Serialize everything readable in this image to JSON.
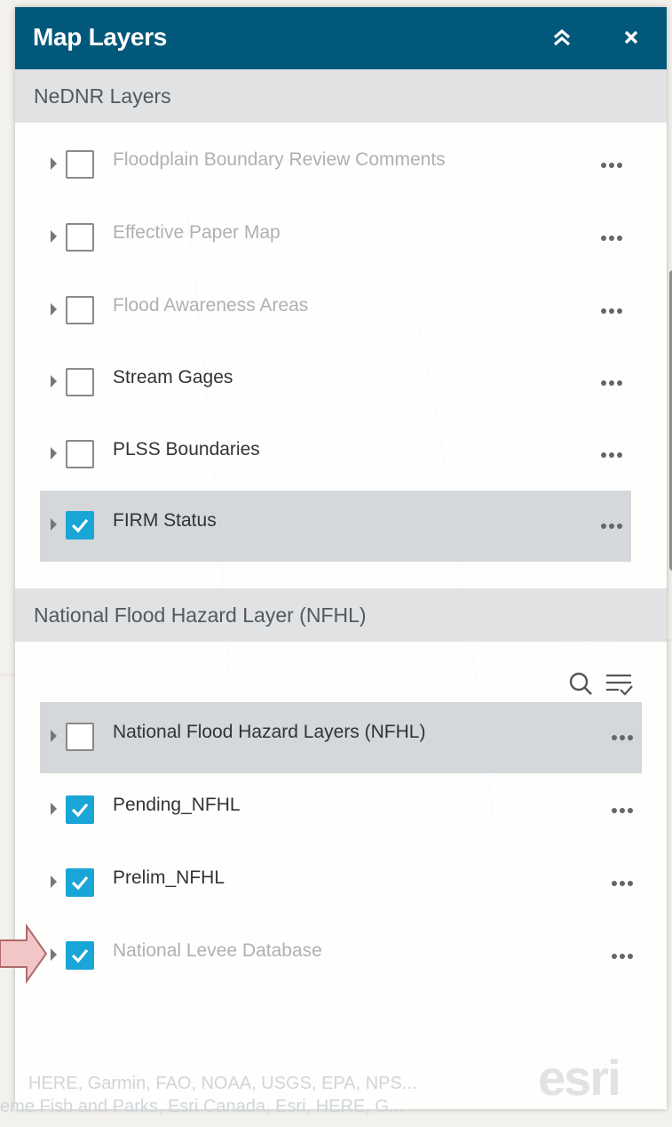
{
  "window": {
    "title": "Map Layers"
  },
  "header_buttons": {
    "collapse_icon": "double-chevron-up-icon",
    "close_icon": "close-icon"
  },
  "groups": [
    {
      "label": "NeDNR Layers",
      "layers": [
        {
          "label": "Floodplain Boundary Review Comments",
          "checked": false,
          "dim": true,
          "selected": false
        },
        {
          "label": "Effective Paper Map",
          "checked": false,
          "dim": true,
          "selected": false
        },
        {
          "label": "Flood Awareness Areas",
          "checked": false,
          "dim": true,
          "selected": false
        },
        {
          "label": "Stream Gages",
          "checked": false,
          "dim": false,
          "selected": false
        },
        {
          "label": "PLSS Boundaries",
          "checked": false,
          "dim": false,
          "selected": false
        },
        {
          "label": "FIRM Status",
          "checked": true,
          "dim": false,
          "selected": true
        }
      ]
    },
    {
      "label": "National Flood Hazard Layer (NFHL)",
      "layers": [
        {
          "label": "National Flood Hazard Layers (NFHL)",
          "checked": false,
          "dim": false,
          "selected": true
        },
        {
          "label": "Pending_NFHL",
          "checked": true,
          "dim": false,
          "selected": false
        },
        {
          "label": "Prelim_NFHL",
          "checked": true,
          "dim": false,
          "selected": false
        },
        {
          "label": "National Levee Database",
          "checked": true,
          "dim": true,
          "selected": false
        }
      ]
    }
  ],
  "tools": {
    "search_icon": "search-icon",
    "filter_icon": "filter-list-icon"
  },
  "attribution": {
    "line1": "HERE, Garmin, FAO, NOAA, USGS, EPA, NPS...",
    "line2": "eme Fish and Parks, Esri Canada, Esri, HERE, G...",
    "logo": "esri"
  },
  "colors": {
    "header": "#02587a",
    "accent": "#1aa5d7",
    "group_header": "#dee0e2"
  }
}
